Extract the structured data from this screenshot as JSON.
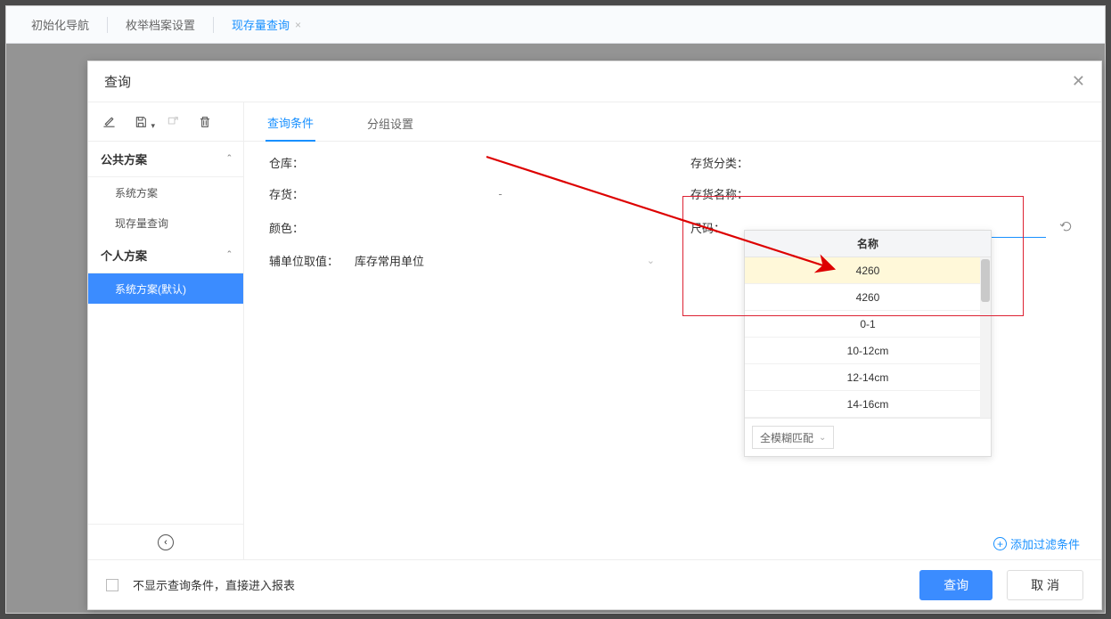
{
  "tabs": {
    "init_nav": "初始化导航",
    "enum_archive": "枚举档案设置",
    "stock_query": "现存量查询"
  },
  "modal": {
    "title": "查询",
    "close_glyph": "✕"
  },
  "sidebar": {
    "sections": {
      "public": "公共方案",
      "personal": "个人方案"
    },
    "items": {
      "system": "系统方案",
      "stock_query": "现存量查询",
      "system_default": "系统方案(默认)"
    },
    "caret_up": "ˆ"
  },
  "condition_tabs": {
    "conditions": "查询条件",
    "group": "分组设置"
  },
  "form": {
    "warehouse": "仓库：",
    "category": "存货分类：",
    "stock": "存货：",
    "stock_value": "-",
    "stock_name": "存货名称：",
    "color": "颜色：",
    "size": "尺码：",
    "aux_unit": "辅单位取值：",
    "aux_unit_value": "库存常用单位"
  },
  "dropdown": {
    "header": "名称",
    "items": [
      "4260",
      "4260",
      "0-1",
      "10-12cm",
      "12-14cm",
      "14-16cm"
    ],
    "match_mode": "全模糊匹配"
  },
  "footer": {
    "skip_conditions": "不显示查询条件，直接进入报表",
    "add_filter": "添加过滤条件",
    "query": "查询",
    "cancel": "取 消"
  }
}
